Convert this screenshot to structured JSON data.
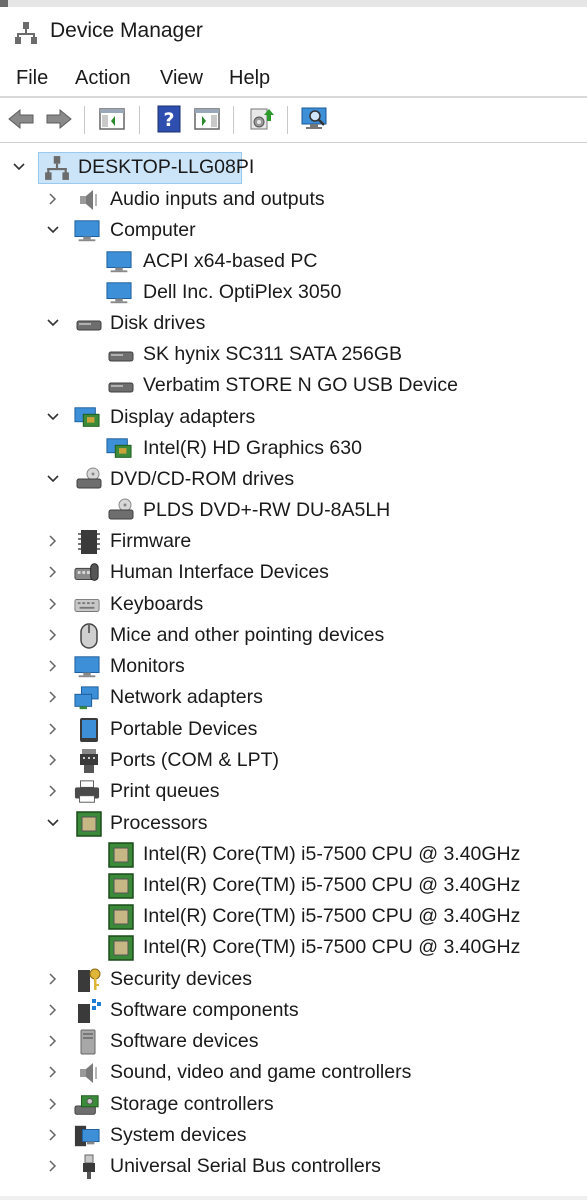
{
  "window": {
    "title": "Device Manager"
  },
  "menu": {
    "file": "File",
    "action": "Action",
    "view": "View",
    "help": "Help"
  },
  "tree": {
    "root": "DESKTOP-LLG08PI",
    "audio": "Audio inputs and outputs",
    "computer": "Computer",
    "computer_children": [
      "ACPI x64-based PC",
      "Dell Inc. OptiPlex 3050"
    ],
    "disk": "Disk drives",
    "disk_children": [
      "SK hynix SC311 SATA 256GB",
      "Verbatim STORE N GO USB Device"
    ],
    "display": "Display adapters",
    "display_children": [
      "Intel(R) HD Graphics 630"
    ],
    "dvd": "DVD/CD-ROM drives",
    "dvd_children": [
      "PLDS DVD+-RW DU-8A5LH"
    ],
    "firmware": "Firmware",
    "hid": "Human Interface Devices",
    "keyboards": "Keyboards",
    "mice": "Mice and other pointing devices",
    "monitors": "Monitors",
    "network": "Network adapters",
    "portable": "Portable Devices",
    "ports": "Ports (COM & LPT)",
    "print": "Print queues",
    "processors": "Processors",
    "processor_children": [
      "Intel(R) Core(TM) i5-7500 CPU @ 3.40GHz",
      "Intel(R) Core(TM) i5-7500 CPU @ 3.40GHz",
      "Intel(R) Core(TM) i5-7500 CPU @ 3.40GHz",
      "Intel(R) Core(TM) i5-7500 CPU @ 3.40GHz"
    ],
    "security": "Security devices",
    "software_components": "Software components",
    "software_devices": "Software devices",
    "sound": "Sound, video and game controllers",
    "storage": "Storage controllers",
    "system": "System devices",
    "usb": "Universal Serial Bus controllers"
  },
  "colors": {
    "selection": "#cce4f7",
    "accent": "#1e7bd6"
  }
}
